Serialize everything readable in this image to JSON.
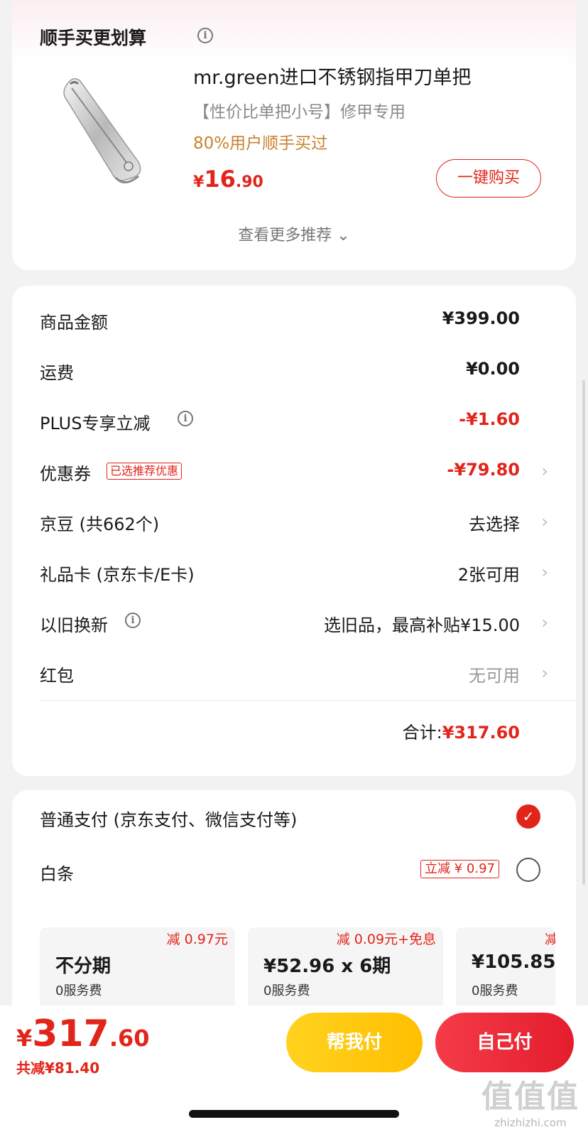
{
  "recommend": {
    "title": "顺手买更划算",
    "product": {
      "name": "mr.green进口不锈钢指甲刀单把",
      "subtitle": "【性价比单把小号】修甲专用",
      "social_proof": "80%用户顺手买过",
      "price_currency": "¥",
      "price_int": "16",
      "price_dec": ".90"
    },
    "buy_label": "一键购买",
    "more_label": "查看更多推荐 ⌄"
  },
  "price_list": {
    "rows": [
      {
        "label": "商品金额",
        "value": "¥399.00"
      },
      {
        "label": "运费",
        "value": "¥0.00"
      },
      {
        "label": "PLUS专享立减",
        "value": "-¥1.60"
      },
      {
        "label": "优惠券",
        "tag": "已选推荐优惠",
        "value": "-¥79.80"
      },
      {
        "label": "京豆 (共662个)",
        "value": "去选择"
      },
      {
        "label": "礼品卡 (京东卡/E卡)",
        "value": "2张可用"
      },
      {
        "label": "以旧换新",
        "value": "选旧品，最高补贴¥15.00"
      },
      {
        "label": "红包",
        "value": "无可用"
      }
    ],
    "total_label": "合计:",
    "total_value": "¥317.60",
    "colors": {
      "accent": "#e1251b"
    }
  },
  "payment": {
    "normal_label": "普通支付 (京东支付、微信支付等)",
    "baitiao_label": "白条",
    "baitiao_tag": "立减 ¥ 0.97",
    "plans": [
      {
        "badge": "减 0.97元",
        "title": "不分期",
        "fee": "0服务费"
      },
      {
        "badge": "减 0.09元+免息",
        "title": "¥52.96 x 6期",
        "fee": "0服务费"
      },
      {
        "badge": "减",
        "title": "¥105.85",
        "fee": "0服务费"
      }
    ]
  },
  "bottom": {
    "price_currency": "¥",
    "price_int": "317",
    "price_dec": ".60",
    "saved": "共减¥81.40",
    "help_pay": "帮我付",
    "self_pay": "自己付",
    "watermark_logo": "值值值",
    "watermark_site": "zhizhizhi.com"
  }
}
